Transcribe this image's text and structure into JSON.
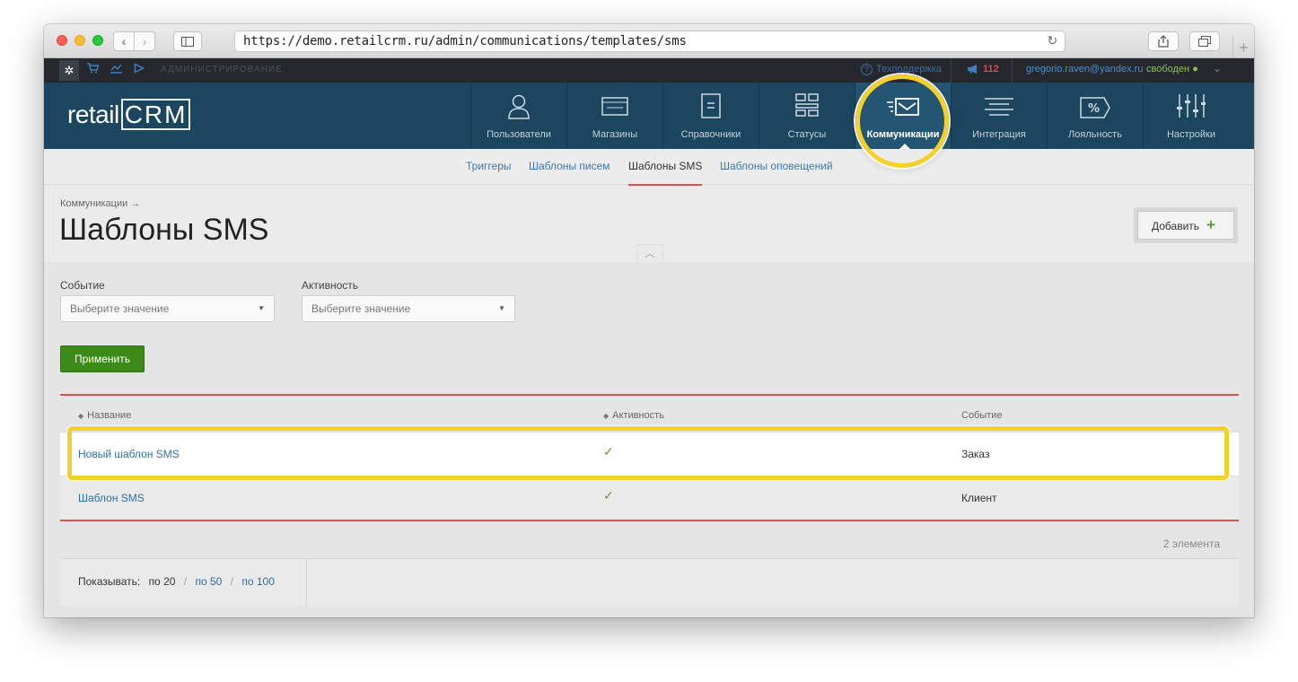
{
  "browser": {
    "url": "https://demo.retailcrm.ru/admin/communications/templates/sms",
    "reload_glyph": "↻",
    "back_glyph": "‹",
    "forward_glyph": "›",
    "new_tab_glyph": "+"
  },
  "adminbar": {
    "label": "АДМИНИСТРИРОВАНИЕ",
    "support": "Техподдержка",
    "notifications_count": "112",
    "user_email": "gregorio.raven@yandex.ru",
    "user_status": "свободен",
    "icons": [
      "gear-icon",
      "cart-icon",
      "chart-icon",
      "play-icon"
    ]
  },
  "header": {
    "logo_text": "retail",
    "logo_crm": "CRM",
    "nav": [
      {
        "label": "Пользователи",
        "icon": "user-icon"
      },
      {
        "label": "Магазины",
        "icon": "store-icon"
      },
      {
        "label": "Справочники",
        "icon": "book-icon"
      },
      {
        "label": "Статусы",
        "icon": "status-grid-icon"
      },
      {
        "label": "Коммуникации",
        "icon": "envelope-icon",
        "active": true
      },
      {
        "label": "Интеграция",
        "icon": "integration-icon"
      },
      {
        "label": "Лояльность",
        "icon": "percent-tag-icon"
      },
      {
        "label": "Настройки",
        "icon": "sliders-icon"
      }
    ]
  },
  "subnav": {
    "tabs": [
      {
        "label": "Триггеры"
      },
      {
        "label": "Шаблоны писем"
      },
      {
        "label": "Шаблоны SMS",
        "active": true
      },
      {
        "label": "Шаблоны оповещений"
      }
    ]
  },
  "page": {
    "breadcrumb": "Коммуникации →",
    "title": "Шаблоны SMS",
    "add_button": "Добавить",
    "add_plus": "+"
  },
  "filters": {
    "event": {
      "label": "Событие",
      "placeholder": "Выберите значение"
    },
    "activity": {
      "label": "Активность",
      "placeholder": "Выберите значение"
    },
    "apply_button": "Применить"
  },
  "table": {
    "columns": [
      "Название",
      "Активность",
      "Событие"
    ],
    "rows": [
      {
        "name": "Новый шаблон SMS",
        "active": "✓",
        "event": "Заказ"
      },
      {
        "name": "Шаблон SMS",
        "active": "✓",
        "event": "Клиент"
      }
    ],
    "count_label": "2 элемента"
  },
  "pager": {
    "label": "Показывать:",
    "options": [
      "по 20",
      "по 50",
      "по 100"
    ],
    "separator": "/"
  },
  "colors": {
    "header_bg": "#1c4660",
    "accent_red": "#d9534f",
    "apply_green": "#3c8a18",
    "highlight_yellow": "#f5cf2a",
    "link_blue": "#2f6ea5"
  }
}
